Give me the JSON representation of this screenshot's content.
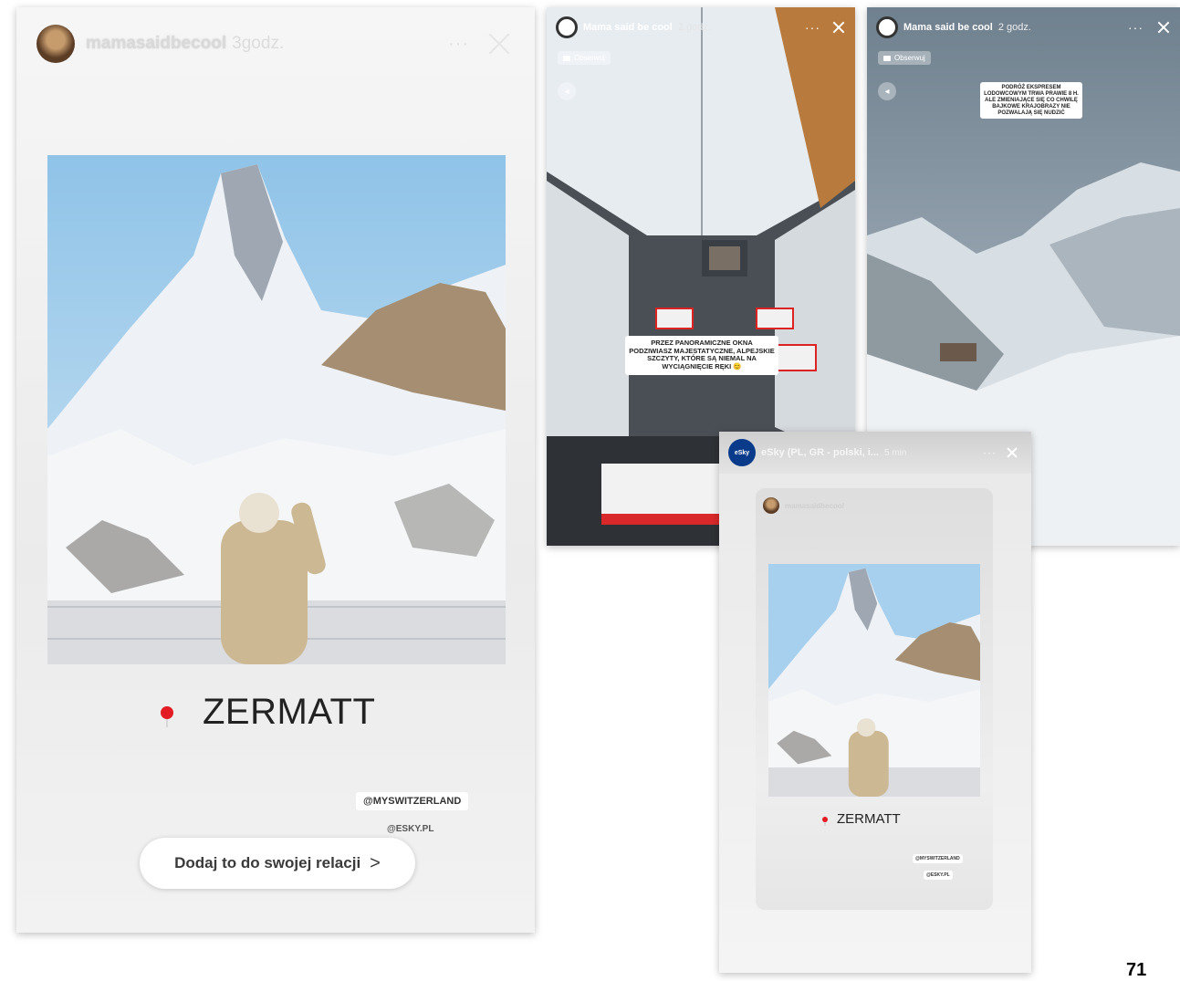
{
  "story_main": {
    "username": "mamasaidbecool",
    "time": "3godz.",
    "dots": "···",
    "location": "ZERMATT",
    "tags": [
      "@MYSWITZERLAND",
      "@ESKY.PL"
    ],
    "add_button": "Dodaj to do swojej relacji",
    "add_chevron": ">"
  },
  "story_train": {
    "username": "Mama said be cool",
    "time": "2 godz.",
    "dots": "···",
    "badge": "Obserwuj",
    "caption": "PRZEZ PANORAMICZNE OKNA PODZIWIASZ MAJESTATYCZNE, ALPEJSKIE SZCZYTY, KTÓRE SĄ NIEMAL NA WYCIĄGNIĘCIE RĘKI 😊"
  },
  "story_valley": {
    "username": "Mama said be cool",
    "time": "2 godz.",
    "dots": "···",
    "badge": "Obserwuj",
    "caption": "PODRÓŻ EKSPRESEM LODOWCOWYM TRWA PRAWIE 8 H. ALE ZMIENIAJĄCE SIĘ CO CHWILĘ BAJKOWE KRAJOBRAZY NIE POZWALAJĄ SIĘ NUDZIĆ"
  },
  "story_repost": {
    "account": "eSky (PL, GR - polski, i...",
    "time": "5 min",
    "dots": "···",
    "avatar_text": "eSky",
    "inner_username": "mamasaidbecool",
    "location": "ZERMATT",
    "tags": [
      "@MYSWITZERLAND",
      "@ESKY.PL"
    ]
  },
  "page_number": "71"
}
